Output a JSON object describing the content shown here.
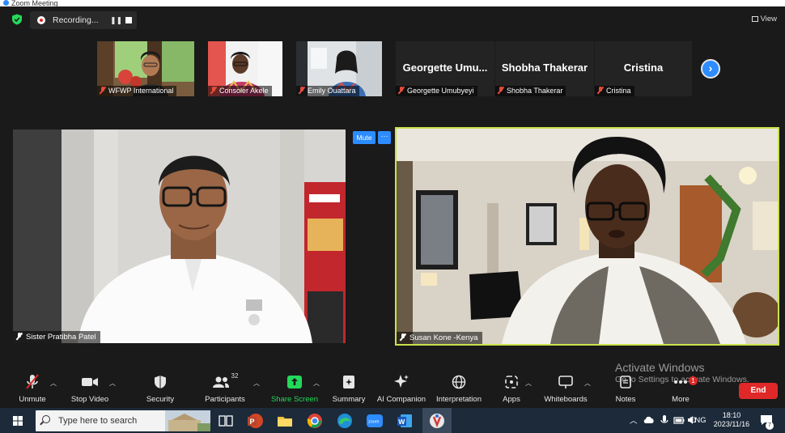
{
  "window": {
    "title": "Zoom Meeting"
  },
  "topbar": {
    "recording_label": "Recording...",
    "pause_symbol": "❚❚",
    "view_label": "View"
  },
  "thumbnails": [
    {
      "name": "WFWP International",
      "kind": "video"
    },
    {
      "name": "Consoler Akele",
      "kind": "video"
    },
    {
      "name": "Emily Ouattara",
      "kind": "video"
    },
    {
      "name": "Georgette Umubyeyi",
      "display": "Georgette Umu...",
      "kind": "name"
    },
    {
      "name": "Shobha Thakerar",
      "display": "Shobha Thakerar",
      "kind": "name"
    },
    {
      "name": "Cristina",
      "display": "Cristina",
      "kind": "name"
    }
  ],
  "main": {
    "left_name": "Sister Pratibha Patel",
    "right_name": "Susan Kone -Kenya",
    "mute_label": "Mute",
    "more_label": "···"
  },
  "watermark": {
    "title": "Activate Windows",
    "subtitle": "Go to Settings to activate Windows."
  },
  "toolbar": {
    "items": [
      {
        "label": "Unmute",
        "icon": "mic-muted-icon"
      },
      {
        "label": "Stop Video",
        "icon": "video-camera-icon"
      },
      {
        "label": "Security",
        "icon": "shield-icon"
      },
      {
        "label": "Participants",
        "icon": "participants-icon",
        "count": "32"
      },
      {
        "label": "Share Screen",
        "icon": "share-screen-icon"
      },
      {
        "label": "Summary",
        "icon": "summary-icon"
      },
      {
        "label": "AI Companion",
        "icon": "sparkle-icon"
      },
      {
        "label": "Interpretation",
        "icon": "globe-icon"
      },
      {
        "label": "Apps",
        "icon": "apps-icon"
      },
      {
        "label": "Whiteboards",
        "icon": "whiteboard-icon"
      },
      {
        "label": "Notes",
        "icon": "notes-icon"
      },
      {
        "label": "More",
        "icon": "more-dots-icon",
        "badge": "1"
      }
    ],
    "end_label": "End",
    "share_color": "#23d959"
  },
  "taskbar": {
    "search_placeholder": "Type here to search",
    "language": "ENG",
    "time": "18:10",
    "date": "2023/11/16",
    "notification_count": "7"
  }
}
